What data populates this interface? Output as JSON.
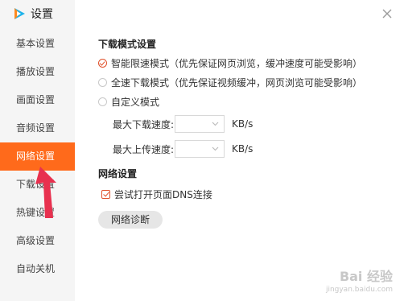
{
  "app": {
    "title": "设置"
  },
  "sidebar": {
    "items": [
      {
        "label": "基本设置"
      },
      {
        "label": "播放设置"
      },
      {
        "label": "画面设置"
      },
      {
        "label": "音频设置"
      },
      {
        "label": "网络设置",
        "active": true
      },
      {
        "label": "下载设置"
      },
      {
        "label": "热键设置"
      },
      {
        "label": "高级设置"
      },
      {
        "label": "自动关机"
      }
    ]
  },
  "download_mode": {
    "title": "下载模式设置",
    "options": [
      {
        "label": "智能限速模式（优先保证网页浏览，缓冲速度可能受影响）",
        "checked": true
      },
      {
        "label": "全速下载模式（优先保证视频缓冲，网页浏览可能受影响）",
        "checked": false
      },
      {
        "label": "自定义模式",
        "checked": false
      }
    ],
    "max_download": {
      "label": "最大下载速度:",
      "value": "",
      "unit": "KB/s"
    },
    "max_upload": {
      "label": "最大上传速度:",
      "value": "",
      "unit": "KB/s"
    }
  },
  "network": {
    "title": "网络设置",
    "dns_option": {
      "label": "尝试打开页面DNS连接",
      "checked": true
    },
    "diagnose_button": "网络诊断"
  },
  "watermark": {
    "line1": "Bai 经验",
    "line2": "jingyan.baidu.com"
  },
  "colors": {
    "accent": "#ff6a1b",
    "check": "#e0502a",
    "annotation_arrow": "#e8314f"
  }
}
